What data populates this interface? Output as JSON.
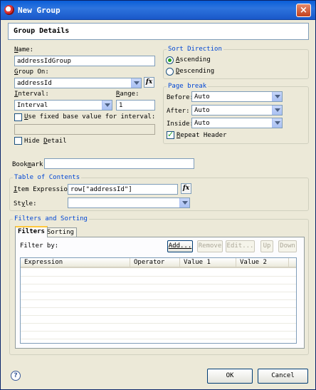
{
  "window": {
    "title": "New Group"
  },
  "header": {
    "title": "Group Details"
  },
  "name": {
    "label_u": "N",
    "label_rest": "ame:",
    "value": "addressIdGroup"
  },
  "group_on": {
    "label_u": "G",
    "label_rest": "roup On:",
    "value": "addressId",
    "fx": "fx"
  },
  "interval": {
    "label_u": "I",
    "label_rest": "nterval:",
    "value": "Interval"
  },
  "range": {
    "label_u": "R",
    "label_rest": "ange:",
    "value": "1"
  },
  "fixed_base": {
    "label_u": "U",
    "label_rest": "se fixed base value for interval:",
    "checked": false,
    "value": ""
  },
  "hide_detail": {
    "label_pre": "Hide ",
    "label_u": "D",
    "label_rest": "etail",
    "checked": false
  },
  "sort_direction": {
    "title": "Sort Direction",
    "ascending": {
      "label_u": "A",
      "label_rest": "scending",
      "checked": true
    },
    "descending": {
      "label_u": "D",
      "label_rest": "escending",
      "checked": false
    }
  },
  "page_break": {
    "title": "Page break",
    "before": {
      "label": "Before:",
      "value": "Auto"
    },
    "after": {
      "label": "After:",
      "value": "Auto"
    },
    "inside": {
      "label": "Inside:",
      "value": "Auto"
    },
    "repeat_header": {
      "label_u": "R",
      "label_rest": "epeat Header",
      "checked": true
    }
  },
  "bookmark": {
    "label_pre": "Book",
    "label_u": "m",
    "label_rest": "ark:",
    "value": ""
  },
  "toc": {
    "title": "Table of Contents",
    "item_expression": {
      "label_u": "I",
      "label_rest": "tem Expression:",
      "value": "row[\"addressId\"]",
      "fx": "fx"
    },
    "style": {
      "label_pre": "St",
      "label_u": "y",
      "label_rest": "le:",
      "value": ""
    }
  },
  "filters_sorting": {
    "title": "Filters and Sorting",
    "tabs": [
      {
        "label": "Filters"
      },
      {
        "label": "Sorting"
      }
    ],
    "filter_by": "Filter by:",
    "buttons": {
      "add": "Add...",
      "remove": "Remove",
      "edit": "Edit...",
      "up": "Up",
      "down": "Down"
    },
    "columns": [
      "Expression",
      "Operator",
      "Value 1",
      "Value 2"
    ]
  },
  "footer": {
    "help": "?",
    "ok": "OK",
    "cancel": "Cancel"
  },
  "colors": {
    "titlebar": "#0a5ed8",
    "dialog_bg": "#ece9d8",
    "group_title": "#0046d5",
    "check": "#21a121"
  }
}
